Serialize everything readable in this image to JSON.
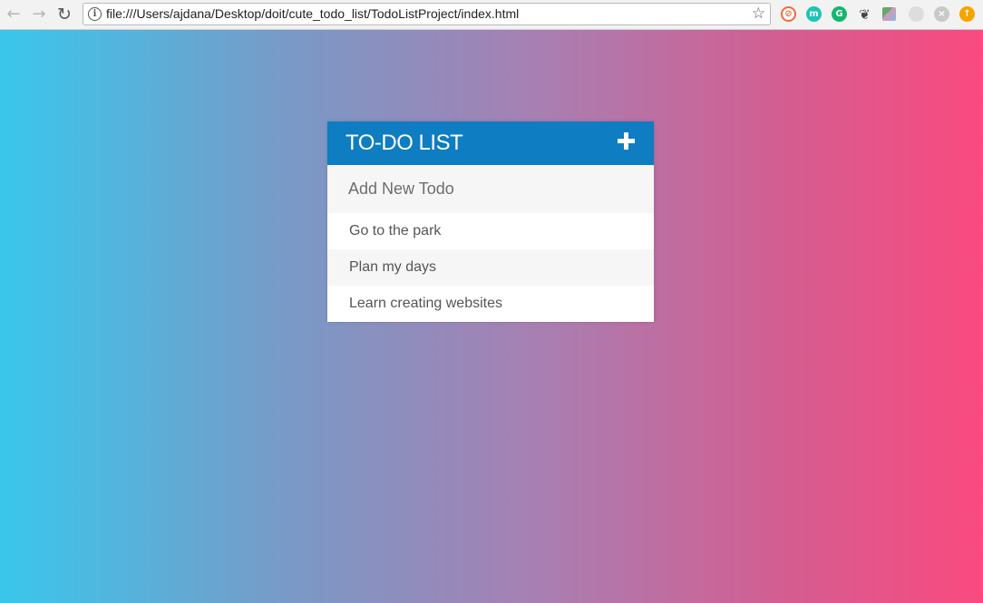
{
  "browser": {
    "url": "file:///Users/ajdana/Desktop/doit/cute_todo_list/TodoListProject/index.html",
    "extensions": [
      "extension-1-icon",
      "extension-m-icon",
      "grammarly-icon",
      "evernote-icon",
      "extension-5-icon",
      "extension-6-icon",
      "extension-7-icon",
      "extension-8-icon"
    ]
  },
  "todo": {
    "title": "TO-DO LIST",
    "input_placeholder": "Add New Todo",
    "items": [
      {
        "text": "Go to the park"
      },
      {
        "text": "Plan my days"
      },
      {
        "text": "Learn creating websites"
      }
    ]
  },
  "colors": {
    "header": "#0e7dc1",
    "gradient_left": "#38c7ec",
    "gradient_right": "#fa4a80"
  }
}
